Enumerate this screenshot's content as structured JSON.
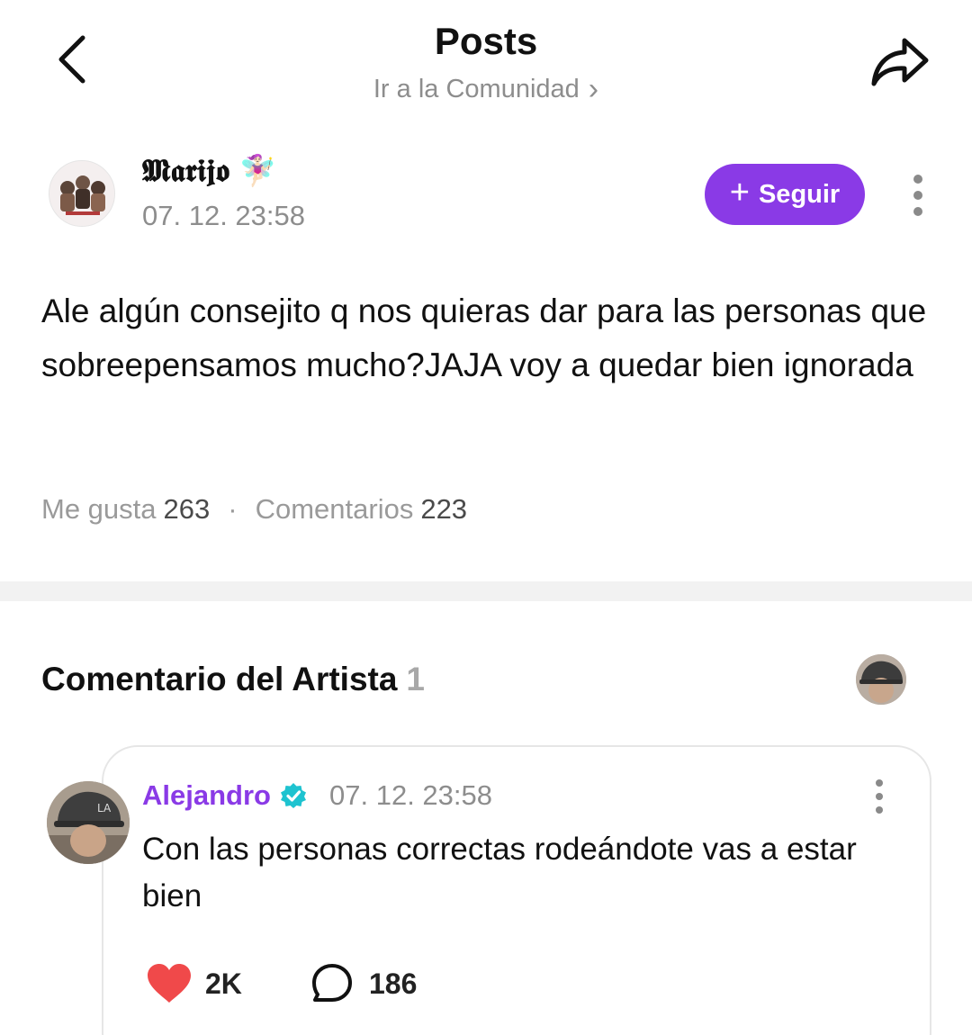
{
  "header": {
    "title": "Posts",
    "subtitle": "Ir a la Comunidad",
    "subtitle_chevron": "›"
  },
  "post": {
    "author": "𝕸𝖆𝖗𝖎𝖏𝖔",
    "author_emoji": "🧚🏻‍♀️",
    "timestamp": "07. 12. 23:58",
    "follow_label": "Seguir",
    "body": "Ale algún consejito q nos quieras dar para las personas que sobreepensamos mucho?JAJA voy a quedar bien ignorada",
    "likes_label": "Me gusta",
    "likes_count": "263",
    "comments_label": "Comentarios",
    "comments_count": "223",
    "separator": "·"
  },
  "artist_comments": {
    "title": "Comentario del Artista",
    "count": "1",
    "comment": {
      "author": "Alejandro",
      "timestamp": "07. 12. 23:58",
      "text": "Con las personas correctas rodeándote vas a estar bien",
      "likes": "2K",
      "replies": "186"
    }
  },
  "colors": {
    "accent": "#8a3ae6",
    "verified": "#1ec3d0",
    "heart": "#f0494a",
    "muted_text": "#8d8d8d"
  },
  "icons": [
    "back-icon",
    "share-icon",
    "chevron-right-icon",
    "plus-icon",
    "more-vertical-icon",
    "verified-badge-icon",
    "heart-icon",
    "comment-bubble-icon"
  ]
}
